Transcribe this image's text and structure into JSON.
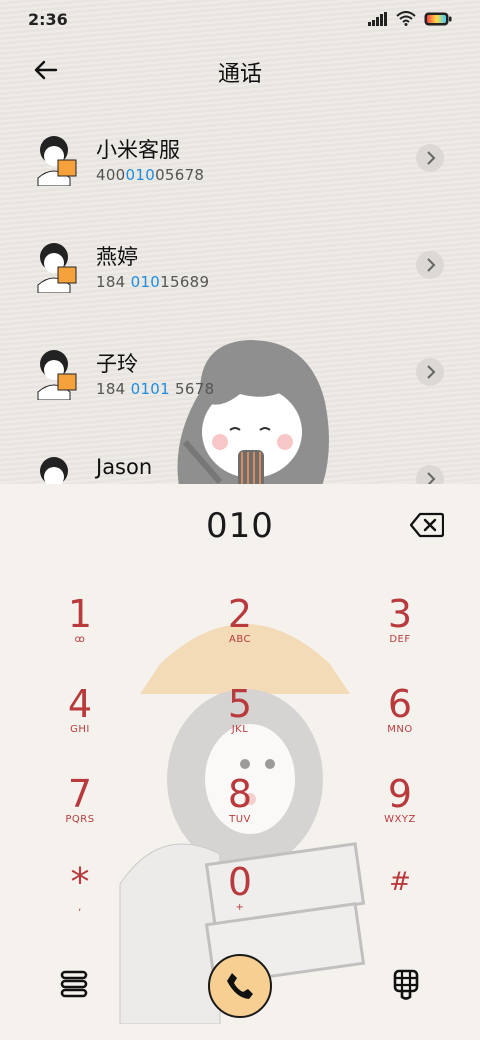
{
  "status": {
    "time": "2:36"
  },
  "header": {
    "title": "通话"
  },
  "contacts": [
    {
      "name": "小米客服",
      "num_pre": "400",
      "num_hl": "010",
      "num_post": "05678"
    },
    {
      "name": "燕婷",
      "num_pre": "184 ",
      "num_hl": "010",
      "num_post": "15689"
    },
    {
      "name": "子玲",
      "num_pre": "184 ",
      "num_hl": "0101",
      "num_post": " 5678"
    },
    {
      "name": "Jason",
      "num_pre": "",
      "num_hl": "",
      "num_post": ""
    }
  ],
  "dialer": {
    "entry": "010"
  },
  "keys": [
    {
      "digit": "1",
      "letters": "ꝏ"
    },
    {
      "digit": "2",
      "letters": "ABC"
    },
    {
      "digit": "3",
      "letters": "DEF"
    },
    {
      "digit": "4",
      "letters": "GHI"
    },
    {
      "digit": "5",
      "letters": "JKL"
    },
    {
      "digit": "6",
      "letters": "MNO"
    },
    {
      "digit": "7",
      "letters": "PQRS"
    },
    {
      "digit": "8",
      "letters": "TUV"
    },
    {
      "digit": "9",
      "letters": "WXYZ"
    },
    {
      "digit": "*",
      "letters": ","
    },
    {
      "digit": "0",
      "letters": "+"
    },
    {
      "digit": "#",
      "letters": ""
    }
  ],
  "colors": {
    "accent": "#b83a3d",
    "highlight": "#1d8de0",
    "call_button": "#f7cf93"
  },
  "icons": [
    "back-arrow-icon",
    "signal-icon",
    "wifi-icon",
    "battery-icon",
    "chevron-right-icon",
    "backspace-icon",
    "menu-icon",
    "phone-icon",
    "dialpad-icon"
  ]
}
